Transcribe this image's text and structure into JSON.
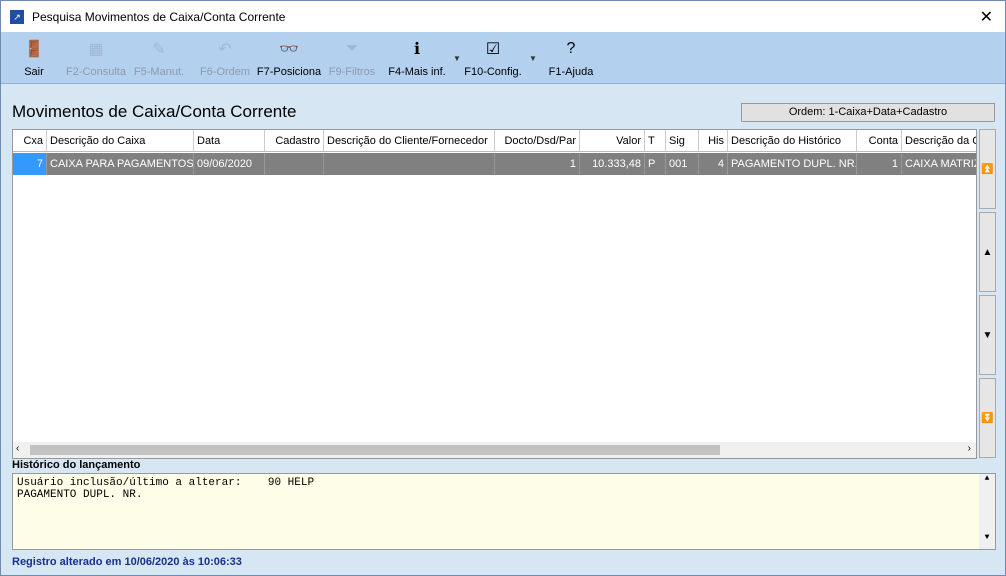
{
  "window": {
    "title": "Pesquisa Movimentos de Caixa/Conta Corrente",
    "close": "✕"
  },
  "toolbar": [
    {
      "label": "Sair",
      "icon": "exit-door-icon",
      "glyph": "🚪",
      "enabled": true
    },
    {
      "label": "F2-Consulta",
      "icon": "calendar-search-icon",
      "glyph": "▦",
      "enabled": false
    },
    {
      "label": "F5-Manut.",
      "icon": "edit-pencil-icon",
      "glyph": "✎",
      "enabled": false
    },
    {
      "label": "F6-Ordem",
      "icon": "undo-arrow-icon",
      "glyph": "↶",
      "enabled": false
    },
    {
      "label": "F7-Posiciona",
      "icon": "binoculars-icon",
      "glyph": "👓",
      "enabled": true
    },
    {
      "label": "F9-Filtros",
      "icon": "funnel-icon",
      "glyph": "⏷",
      "enabled": false
    },
    {
      "label": "F4-Mais inf.",
      "icon": "info-icon",
      "glyph": "ℹ",
      "enabled": true
    },
    {
      "label": "F10-Config.",
      "icon": "checklist-icon",
      "glyph": "☑",
      "enabled": true
    },
    {
      "label": "F1-Ajuda",
      "icon": "help-icon",
      "glyph": "?",
      "enabled": true
    }
  ],
  "heading": "Movimentos de Caixa/Conta Corrente",
  "ordem": "Ordem: 1-Caixa+Data+Cadastro",
  "grid": {
    "columns": [
      "Cxa",
      "Descrição do Caixa",
      "Data",
      "Cadastro",
      "Descrição do Cliente/Fornecedor",
      "Docto/Dsd/Par",
      "Valor",
      "T",
      "Sig",
      "His",
      "Descrição do Histórico",
      "Conta",
      "Descrição da Conta"
    ],
    "rows": [
      [
        "7",
        "CAIXA PARA PAGAMENTOS",
        "09/06/2020",
        "",
        "",
        "1",
        "10.333,48",
        "P",
        "001",
        "4",
        "PAGAMENTO DUPL. NR.",
        "1",
        "CAIXA MATRIZ"
      ]
    ]
  },
  "nav": [
    "⏫",
    "▲",
    "▼",
    "⏬"
  ],
  "historico_label": "Histórico do lançamento",
  "historico_text": "Usuário inclusão/último a alterar:    90 HELP\nPAGAMENTO DUPL. NR.",
  "status": "Registro alterado em 10/06/2020 às 10:06:33"
}
